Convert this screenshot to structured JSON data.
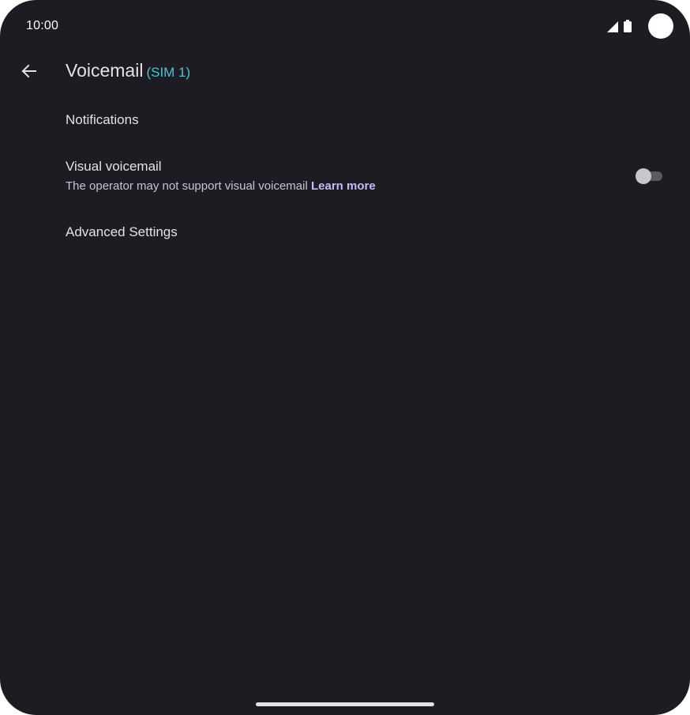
{
  "status_bar": {
    "time": "10:00",
    "icons": [
      "cellular-signal-icon",
      "battery-icon",
      "camera-cutout"
    ]
  },
  "app_bar": {
    "back_icon": "arrow-back-icon",
    "title": "Voicemail",
    "subtitle": "(SIM 1)"
  },
  "preferences": {
    "notifications": {
      "title": "Notifications"
    },
    "visual_voicemail": {
      "title": "Visual voicemail",
      "summary": "The operator may not support visual voicemail",
      "link": "Learn more",
      "switch_on": false
    },
    "advanced": {
      "title": "Advanced Settings"
    }
  },
  "colors": {
    "background": "#1d1c22",
    "text_primary": "#e6e1e9",
    "text_secondary": "#c9c4cf",
    "subtitle_accent": "#4fc3d9",
    "link_accent": "#c3bdf6"
  }
}
